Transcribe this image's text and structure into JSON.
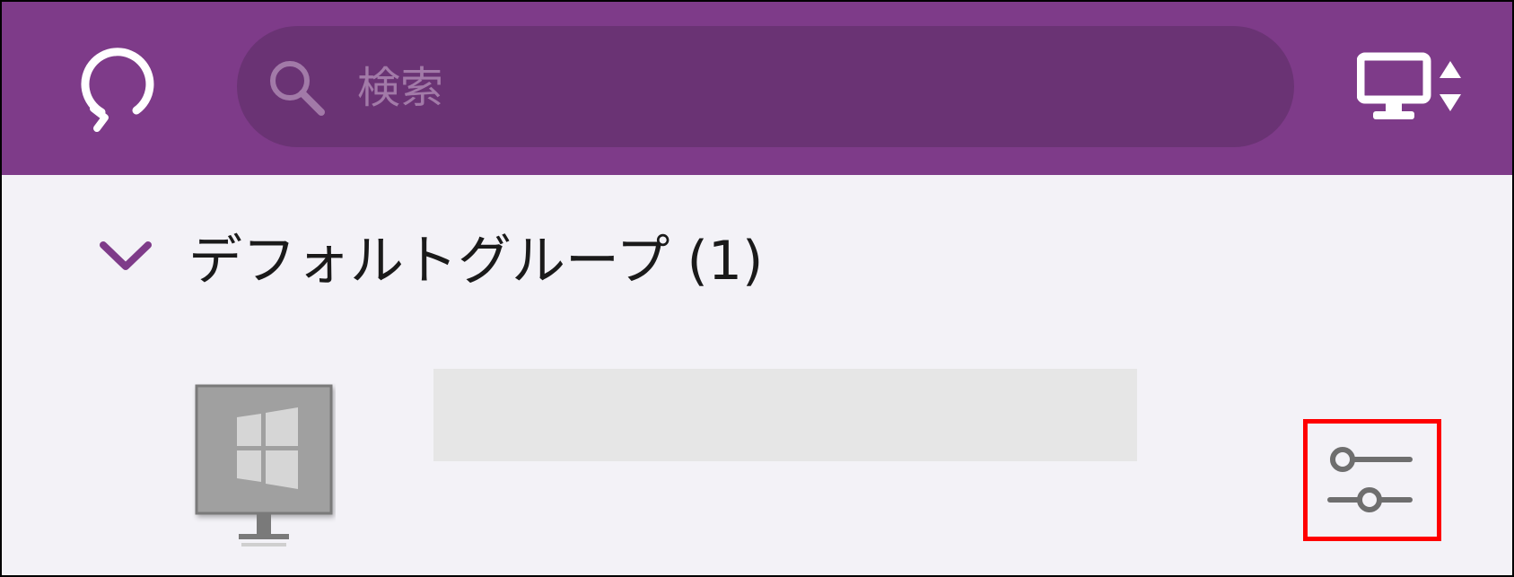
{
  "header": {
    "refresh_icon": "refresh-icon",
    "search": {
      "icon": "search-icon",
      "placeholder": "検索",
      "value": ""
    },
    "view_toggle_icon": "monitor-sort-icon",
    "background_color": "#7e3b89",
    "search_background_color": "#6a3374"
  },
  "group": {
    "label": "デフォルトグループ (1)",
    "expanded": true,
    "chevron_icon": "chevron-down-icon"
  },
  "device": {
    "icon": "windows-monitor-icon",
    "name_visible": false,
    "settings_icon": "sliders-settings-icon",
    "highlight_color": "#ff0000"
  }
}
